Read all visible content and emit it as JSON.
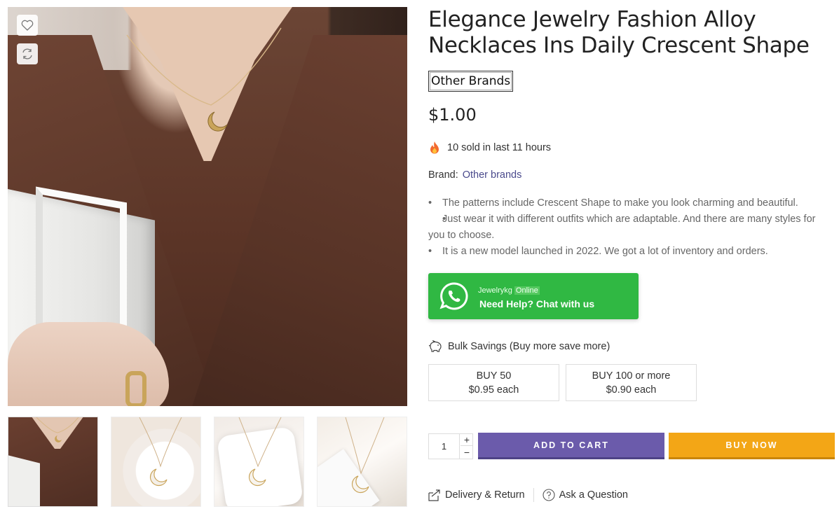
{
  "product": {
    "title": "Elegance Jewelry Fashion Alloy Necklaces Ins Daily Crescent Shape",
    "brand_badge": "Other Brands",
    "price": "$1.00",
    "sold_text": "10 sold in last 11 hours",
    "brand_label": "Brand:",
    "brand_value": "Other brands",
    "bullets": [
      "The patterns include Crescent Shape to make you look charming and beautiful.",
      "Just wear it with different outfits which are adaptable. And there are many styles for you to choose.",
      "It is a new model launched in 2022. We got a lot of inventory and orders."
    ]
  },
  "whatsapp": {
    "name": "Jewelrykg",
    "status": "Online",
    "cta": "Need Help? Chat with us",
    "color": "#30b843"
  },
  "bulk": {
    "title": "Bulk Savings (Buy more save more)",
    "tiers": [
      {
        "qty": "BUY 50",
        "price": "$0.95 each"
      },
      {
        "qty": "BUY 100 or more",
        "price": "$0.90 each"
      }
    ]
  },
  "cart": {
    "quantity": "1",
    "plus": "+",
    "minus": "−",
    "add_to_cart": "ADD TO CART",
    "buy_now": "BUY NOW",
    "add_color": "#6b5bab",
    "buy_color": "#f3a616"
  },
  "links": {
    "delivery": "Delivery & Return",
    "ask": "Ask a Question"
  },
  "icons": {
    "wishlist": "heart-icon",
    "compare": "compare-icon",
    "fire": "fire-icon",
    "whatsapp": "whatsapp-icon",
    "bulk": "piggy-bank-icon",
    "delivery": "delivery-box-icon",
    "ask": "question-circle-icon"
  }
}
